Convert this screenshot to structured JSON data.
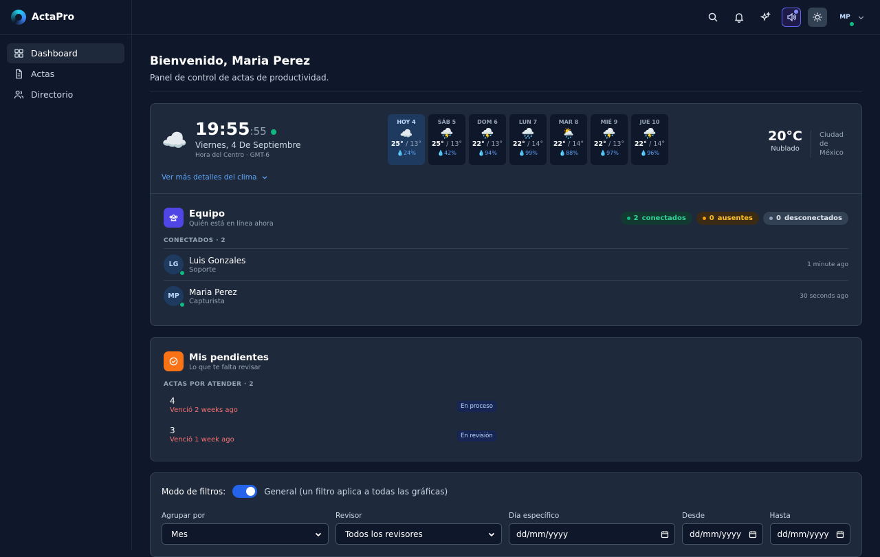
{
  "app": {
    "name": "ActaPro"
  },
  "nav": [
    {
      "label": "Dashboard",
      "icon": "grid-icon",
      "active": true
    },
    {
      "label": "Actas",
      "icon": "document-icon",
      "active": false
    },
    {
      "label": "Directorio",
      "icon": "users-icon",
      "active": false
    }
  ],
  "topbar": {
    "user_initials": "MP"
  },
  "header": {
    "title": "Bienvenido, Maria Perez",
    "subtitle": "Panel de control de actas de productividad."
  },
  "weather": {
    "time": "19:55",
    "seconds": ":55",
    "date": "Viernes, 4 De Septiembre",
    "timezone": "Hora del Centro · GMT-6",
    "forecast": [
      {
        "day": "HOY 4",
        "icon": "☁️",
        "hi": "25°",
        "lo": "/ 13°",
        "rain": "💧24%"
      },
      {
        "day": "SÁB 5",
        "icon": "⛈️",
        "hi": "25°",
        "lo": "/ 13°",
        "rain": "💧42%"
      },
      {
        "day": "DOM 6",
        "icon": "⛈️",
        "hi": "22°",
        "lo": "/ 13°",
        "rain": "💧94%"
      },
      {
        "day": "LUN 7",
        "icon": "🌧️",
        "hi": "22°",
        "lo": "/ 14°",
        "rain": "💧99%"
      },
      {
        "day": "MAR 8",
        "icon": "🌦️",
        "hi": "22°",
        "lo": "/ 14°",
        "rain": "💧88%"
      },
      {
        "day": "MIÉ 9",
        "icon": "⛈️",
        "hi": "22°",
        "lo": "/ 13°",
        "rain": "💧97%"
      },
      {
        "day": "JUE 10",
        "icon": "⛈️",
        "hi": "22°",
        "lo": "/ 14°",
        "rain": "💧96%"
      }
    ],
    "current_temp": "20°C",
    "condition": "Nublado",
    "city": "Ciudad de México",
    "more_link": "Ver más detalles del clima"
  },
  "team": {
    "title": "Equipo",
    "subtitle": "Quién está en línea ahora",
    "connected_count": "2",
    "connected_label": "conectados",
    "away_count": "0",
    "away_label": "ausentes",
    "offline_count": "0",
    "offline_label": "desconectados",
    "list_label": "CONECTADOS · 2",
    "members": [
      {
        "initials": "LG",
        "name": "Luis Gonzales",
        "role": "Soporte",
        "seen": "1 minute ago"
      },
      {
        "initials": "MP",
        "name": "Maria Perez",
        "role": "Capturista",
        "seen": "30 seconds ago"
      }
    ]
  },
  "pending": {
    "title": "Mis pendientes",
    "subtitle": "Lo que te falta revisar",
    "list_label": "ACTAS POR ATENDER · 2",
    "items": [
      {
        "id": "4",
        "due": "Venció 2 weeks ago",
        "status": "En proceso"
      },
      {
        "id": "3",
        "due": "Venció 1 week ago",
        "status": "En revisión"
      }
    ]
  },
  "filters": {
    "mode_label": "Modo de filtros:",
    "mode_desc": "General (un filtro aplica a todas las gráficas)",
    "group_label": "Agrupar por",
    "group_value": "Mes",
    "reviewer_label": "Revisor",
    "reviewer_value": "Todos los revisores",
    "day_label": "Día específico",
    "day_value": "dd/mm/yyyy",
    "from_label": "Desde",
    "from_value": "dd/mm/yyyy",
    "to_label": "Hasta",
    "to_value": "dd/mm/yyyy"
  },
  "colors": {
    "accent": "#2563eb",
    "online": "#10b981",
    "away": "#f59e0b",
    "danger": "#f87171"
  }
}
